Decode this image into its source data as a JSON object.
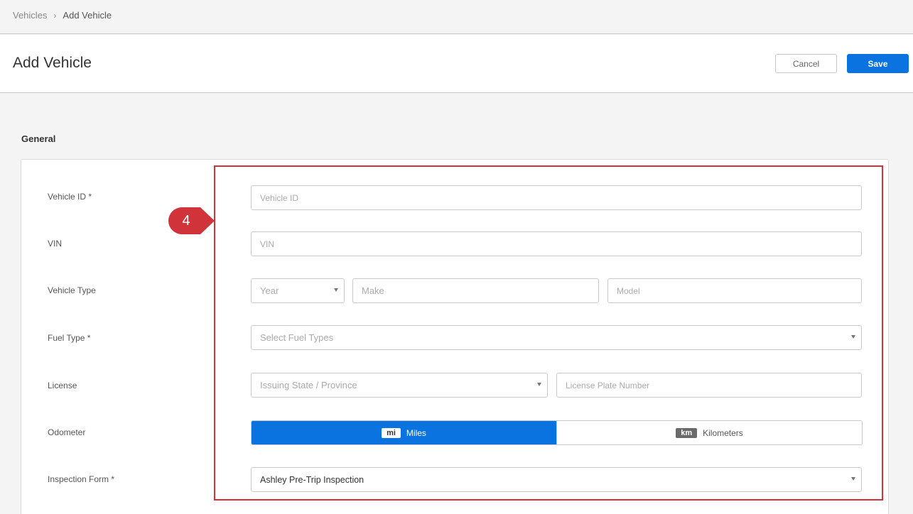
{
  "breadcrumb": {
    "parent": "Vehicles",
    "separator": "›",
    "current": "Add Vehicle"
  },
  "header": {
    "title": "Add Vehicle",
    "cancel_label": "Cancel",
    "save_label": "Save"
  },
  "section": {
    "title": "General"
  },
  "form": {
    "vehicle_id": {
      "label": "Vehicle ID *",
      "placeholder": "Vehicle ID"
    },
    "vin": {
      "label": "VIN",
      "placeholder": "VIN"
    },
    "vehicle_type": {
      "label": "Vehicle Type",
      "year_placeholder": "Year",
      "make_placeholder": "Make",
      "model_placeholder": "Model"
    },
    "fuel_type": {
      "label": "Fuel Type *",
      "placeholder": "Select Fuel Types"
    },
    "license": {
      "label": "License",
      "state_placeholder": "Issuing State / Province",
      "plate_placeholder": "License Plate Number"
    },
    "odometer": {
      "label": "Odometer",
      "options": [
        {
          "badge": "mi",
          "label": "Miles",
          "selected": true
        },
        {
          "badge": "km",
          "label": "Kilometers",
          "selected": false
        }
      ]
    },
    "inspection_form": {
      "label": "Inspection Form *",
      "value": "Ashley Pre-Trip Inspection"
    }
  },
  "annotation": {
    "step_number": "4"
  },
  "colors": {
    "accent": "#0a73e0",
    "highlight": "#d0343a"
  },
  "icons": {
    "dropdown": "caret-down-icon",
    "breadcrumb_separator": "chevron-right-icon"
  }
}
